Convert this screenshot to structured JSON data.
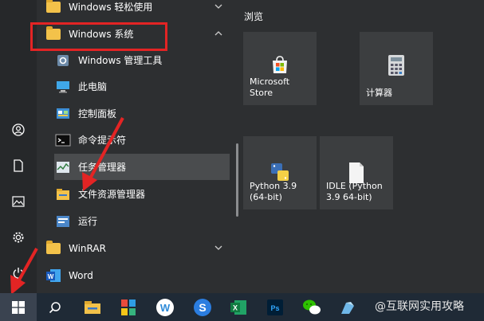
{
  "start_menu": {
    "apps": [
      {
        "label": "Windows 轻松使用",
        "icon": "folder-icon",
        "expanded": false
      },
      {
        "label": "Windows 系统",
        "icon": "folder-icon",
        "expanded": true
      },
      {
        "label": "Windows 管理工具",
        "icon": "admin-tools-icon"
      },
      {
        "label": "此电脑",
        "icon": "computer-icon"
      },
      {
        "label": "控制面板",
        "icon": "control-panel-icon"
      },
      {
        "label": "命令提示符",
        "icon": "cmd-icon"
      },
      {
        "label": "任务管理器",
        "icon": "task-manager-icon"
      },
      {
        "label": "文件资源管理器",
        "icon": "file-explorer-icon"
      },
      {
        "label": "运行",
        "icon": "run-icon"
      },
      {
        "label": "WinRAR",
        "icon": "folder-icon",
        "expanded": false
      },
      {
        "label": "Word",
        "icon": "word-icon"
      }
    ],
    "tile_group_title": "浏览",
    "tiles": [
      {
        "label": "Microsoft Store",
        "icon": "store-icon"
      },
      {
        "label": "计算器",
        "icon": "calculator-icon"
      },
      {
        "label": "Python 3.9 (64-bit)",
        "icon": "python-icon"
      },
      {
        "label": "IDLE (Python 3.9 64-bit)",
        "icon": "idle-icon"
      }
    ]
  },
  "rail": [
    "user-icon",
    "document-icon",
    "pictures-icon",
    "settings-icon",
    "power-icon"
  ],
  "taskbar": {
    "items": [
      "search-icon",
      "file-explorer-icon",
      "app-icon",
      "browser-icon",
      "sogou-icon",
      "excel-icon",
      "photoshop-icon",
      "wechat-icon",
      "sketch-icon"
    ],
    "watermark": "@互联网实用攻略"
  },
  "colors": {
    "highlight": "#e32424",
    "folder": "#f3c24a",
    "taskbar": "#1f2a36"
  }
}
